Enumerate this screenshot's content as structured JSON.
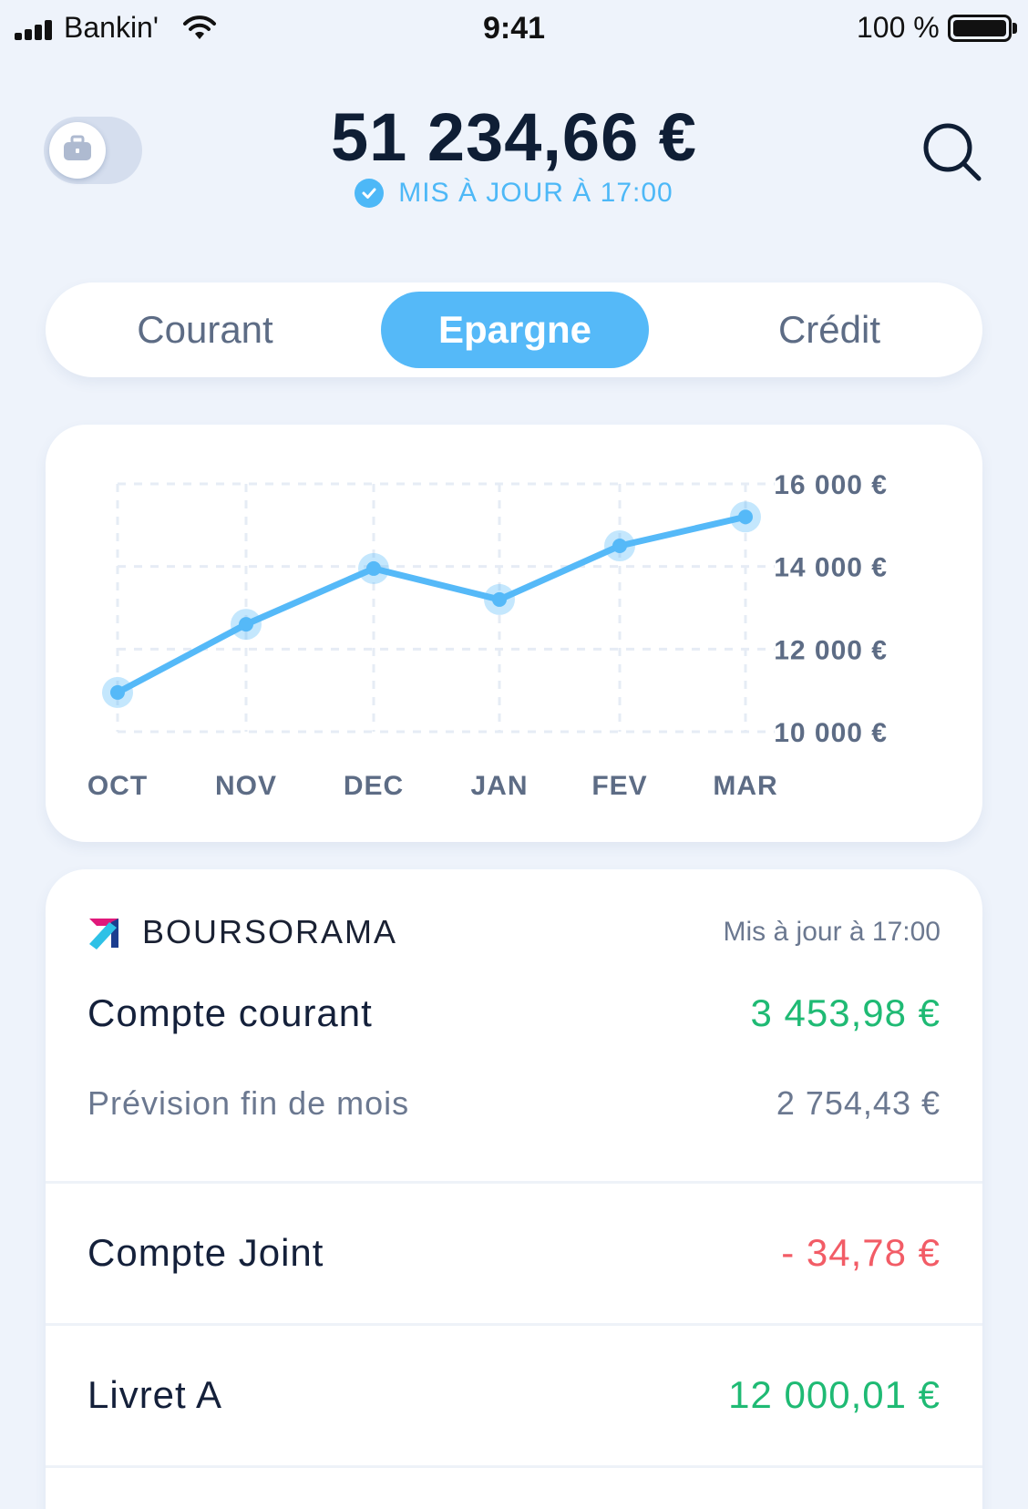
{
  "status_bar": {
    "carrier": "Bankin'",
    "time": "9:41",
    "battery": "100 %"
  },
  "header": {
    "total_balance": "51 234,66 €",
    "updated_label": "MIS À JOUR À 17:00",
    "toggle_icon": "briefcase-icon",
    "search_icon": "search-icon"
  },
  "tabs": [
    {
      "label": "Courant",
      "active": false
    },
    {
      "label": "Epargne",
      "active": true
    },
    {
      "label": "Crédit",
      "active": false
    }
  ],
  "chart_data": {
    "type": "line",
    "categories": [
      "OCT",
      "NOV",
      "DEC",
      "JAN",
      "FEV",
      "MAR"
    ],
    "values": [
      10950,
      12600,
      13950,
      13200,
      14500,
      15200
    ],
    "y_ticks": [
      "16 000 €",
      "14 000 €",
      "12 000 €",
      "10 000 €"
    ],
    "ylim": [
      10000,
      16000
    ],
    "color": "#55b9f8",
    "grid": true
  },
  "accounts": {
    "bank_name": "BOURSORAMA",
    "bank_updated": "Mis à jour à 17:00",
    "compte_courant": {
      "label": "Compte courant",
      "value": "3 453,98 €",
      "color": "#1fba74"
    },
    "prevision": {
      "label": "Prévision fin de mois",
      "value": "2 754,43 €"
    },
    "compte_joint": {
      "label": "Compte Joint",
      "value": "- 34,78 €",
      "color": "#f25c66"
    },
    "livret_a": {
      "label": "Livret A",
      "value": "12 000,01 €",
      "color": "#1fba74"
    }
  },
  "colors": {
    "accent": "#55b9f8",
    "positive": "#1fba74",
    "negative": "#f25c66"
  }
}
